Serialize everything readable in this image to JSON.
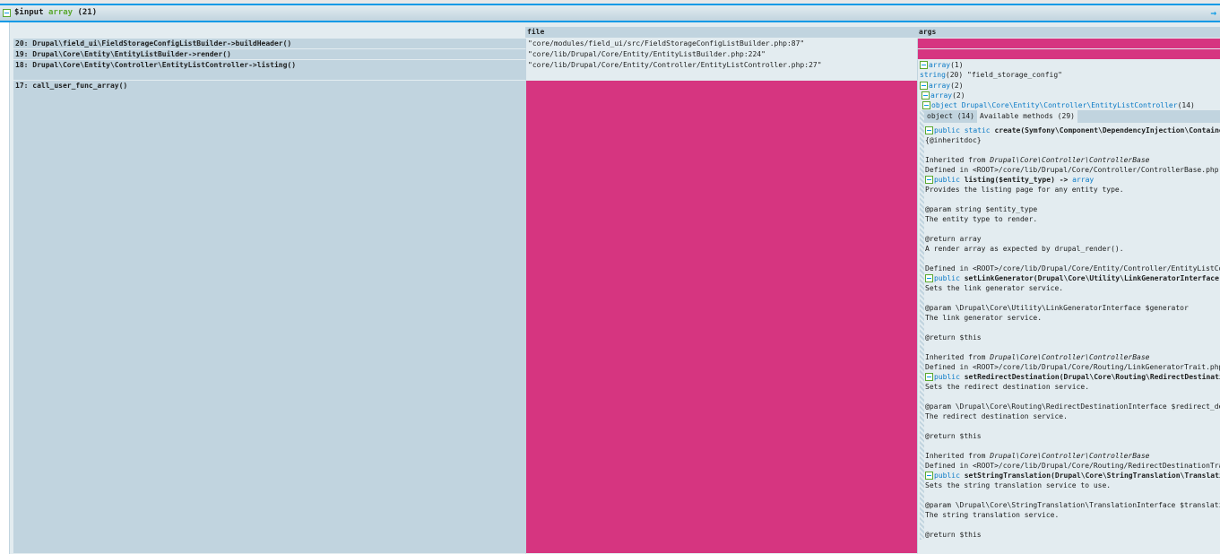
{
  "header": {
    "var": "$input",
    "type": "array",
    "count": "(21)",
    "expand_icon": "arrow-right"
  },
  "table": {
    "columns": [
      "",
      "file",
      "args"
    ],
    "rows": [
      {
        "frame": "20: Drupal\\field_ui\\FieldStorageConfigListBuilder->buildHeader()",
        "file": "\"core/modules/field_ui/src/FieldStorageConfigListBuilder.php:87\""
      },
      {
        "frame": "19: Drupal\\Core\\Entity\\EntityListBuilder->render()",
        "file": "\"core/lib/Drupal/Core/Entity/EntityListBuilder.php:224\""
      },
      {
        "frame": "18: Drupal\\Core\\Entity\\Controller\\EntityListController->listing()",
        "file": "\"core/lib/Drupal/Core/Entity/Controller/EntityListController.php:27\"",
        "args": {
          "type": "array",
          "count": "(1)",
          "value_type": "string",
          "value_len": "(20)",
          "value": "\"field_storage_config\""
        }
      },
      {
        "frame": "17: call_user_func_array()"
      }
    ]
  },
  "args17": {
    "a1": "array",
    "a1c": "(2)",
    "a2": "array",
    "a2c": "(2)",
    "obj_kw": "object",
    "obj_class": "Drupal\\Core\\Entity\\Controller\\EntityListController",
    "obj_count": "(14)",
    "tabs": [
      "object (14)",
      "Available methods (29)"
    ],
    "methods": [
      {
        "mod": "public static",
        "sig": "create(Symfony\\Component\\DependencyInjection\\ContainerInterface $container)",
        "lines": [
          "{@inheritdoc}",
          "",
          "@INH:Drupal\\Core\\Controller\\ControllerBase",
          "Defined in <ROOT>/core/lib/Drupal/Core/Controller/ControllerBase.php"
        ]
      },
      {
        "mod": "public",
        "sig": "listing($entity_type) -> ",
        "ret": "array",
        "lines": [
          "Provides the listing page for any entity type.",
          "",
          "@param string $entity_type",
          "The entity type to render.",
          "",
          "@return array",
          "A render array as expected by drupal_render().",
          "",
          "Defined in <ROOT>/core/lib/Drupal/Core/Entity/Controller/EntityListController.php"
        ]
      },
      {
        "mod": "public",
        "sig": "setLinkGenerator(Drupal\\Core\\Utility\\LinkGeneratorInterface $generator)",
        "lines": [
          "Sets the link generator service.",
          "",
          "@param \\Drupal\\Core\\Utility\\LinkGeneratorInterface $generator",
          "The link generator service.",
          "",
          "@return $this",
          "",
          "@INH:Drupal\\Core\\Controller\\ControllerBase",
          "Defined in <ROOT>/core/lib/Drupal/Core/Routing/LinkGeneratorTrait.php"
        ]
      },
      {
        "mod": "public",
        "sig": "setRedirectDestination(Drupal\\Core\\Routing\\RedirectDestinationInterface $redirect_destination)",
        "lines": [
          "Sets the redirect destination service.",
          "",
          "@param \\Drupal\\Core\\Routing\\RedirectDestinationInterface $redirect_destination",
          "The redirect destination service.",
          "",
          "@return $this",
          "",
          "@INH:Drupal\\Core\\Controller\\ControllerBase",
          "Defined in <ROOT>/core/lib/Drupal/Core/Routing/RedirectDestinationTrait.php"
        ]
      },
      {
        "mod": "public",
        "sig": "setStringTranslation(Drupal\\Core\\StringTranslation\\TranslationInterface $translation)",
        "lines": [
          "Sets the string translation service to use.",
          "",
          "@param \\Drupal\\Core\\StringTranslation\\TranslationInterface $translation",
          "The string translation service.",
          "",
          "@return $this"
        ]
      }
    ],
    "inherited_label": "Inherited from "
  },
  "colors": {
    "accent": "#0b9ae6",
    "pink": "#d63580",
    "panel": "#c1d4df",
    "bg": "#e3ecf0"
  }
}
